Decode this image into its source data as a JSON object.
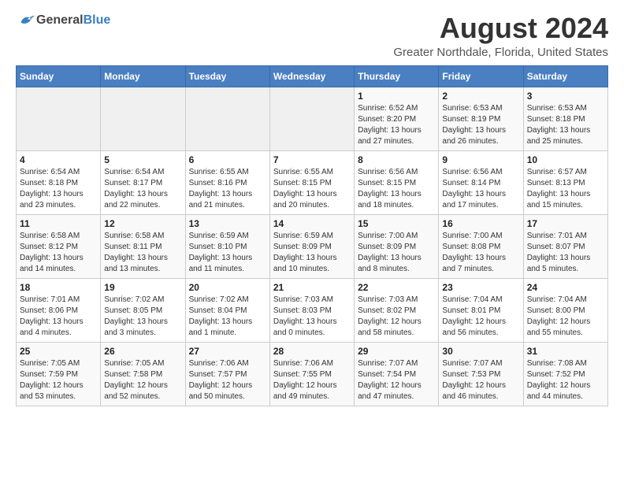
{
  "header": {
    "logo_general": "General",
    "logo_blue": "Blue",
    "title": "August 2024",
    "subtitle": "Greater Northdale, Florida, United States"
  },
  "weekdays": [
    "Sunday",
    "Monday",
    "Tuesday",
    "Wednesday",
    "Thursday",
    "Friday",
    "Saturday"
  ],
  "weeks": [
    [
      {
        "day": "",
        "detail": ""
      },
      {
        "day": "",
        "detail": ""
      },
      {
        "day": "",
        "detail": ""
      },
      {
        "day": "",
        "detail": ""
      },
      {
        "day": "1",
        "detail": "Sunrise: 6:52 AM\nSunset: 8:20 PM\nDaylight: 13 hours and 27 minutes."
      },
      {
        "day": "2",
        "detail": "Sunrise: 6:53 AM\nSunset: 8:19 PM\nDaylight: 13 hours and 26 minutes."
      },
      {
        "day": "3",
        "detail": "Sunrise: 6:53 AM\nSunset: 8:18 PM\nDaylight: 13 hours and 25 minutes."
      }
    ],
    [
      {
        "day": "4",
        "detail": "Sunrise: 6:54 AM\nSunset: 8:18 PM\nDaylight: 13 hours and 23 minutes."
      },
      {
        "day": "5",
        "detail": "Sunrise: 6:54 AM\nSunset: 8:17 PM\nDaylight: 13 hours and 22 minutes."
      },
      {
        "day": "6",
        "detail": "Sunrise: 6:55 AM\nSunset: 8:16 PM\nDaylight: 13 hours and 21 minutes."
      },
      {
        "day": "7",
        "detail": "Sunrise: 6:55 AM\nSunset: 8:15 PM\nDaylight: 13 hours and 20 minutes."
      },
      {
        "day": "8",
        "detail": "Sunrise: 6:56 AM\nSunset: 8:15 PM\nDaylight: 13 hours and 18 minutes."
      },
      {
        "day": "9",
        "detail": "Sunrise: 6:56 AM\nSunset: 8:14 PM\nDaylight: 13 hours and 17 minutes."
      },
      {
        "day": "10",
        "detail": "Sunrise: 6:57 AM\nSunset: 8:13 PM\nDaylight: 13 hours and 15 minutes."
      }
    ],
    [
      {
        "day": "11",
        "detail": "Sunrise: 6:58 AM\nSunset: 8:12 PM\nDaylight: 13 hours and 14 minutes."
      },
      {
        "day": "12",
        "detail": "Sunrise: 6:58 AM\nSunset: 8:11 PM\nDaylight: 13 hours and 13 minutes."
      },
      {
        "day": "13",
        "detail": "Sunrise: 6:59 AM\nSunset: 8:10 PM\nDaylight: 13 hours and 11 minutes."
      },
      {
        "day": "14",
        "detail": "Sunrise: 6:59 AM\nSunset: 8:09 PM\nDaylight: 13 hours and 10 minutes."
      },
      {
        "day": "15",
        "detail": "Sunrise: 7:00 AM\nSunset: 8:09 PM\nDaylight: 13 hours and 8 minutes."
      },
      {
        "day": "16",
        "detail": "Sunrise: 7:00 AM\nSunset: 8:08 PM\nDaylight: 13 hours and 7 minutes."
      },
      {
        "day": "17",
        "detail": "Sunrise: 7:01 AM\nSunset: 8:07 PM\nDaylight: 13 hours and 5 minutes."
      }
    ],
    [
      {
        "day": "18",
        "detail": "Sunrise: 7:01 AM\nSunset: 8:06 PM\nDaylight: 13 hours and 4 minutes."
      },
      {
        "day": "19",
        "detail": "Sunrise: 7:02 AM\nSunset: 8:05 PM\nDaylight: 13 hours and 3 minutes."
      },
      {
        "day": "20",
        "detail": "Sunrise: 7:02 AM\nSunset: 8:04 PM\nDaylight: 13 hours and 1 minute."
      },
      {
        "day": "21",
        "detail": "Sunrise: 7:03 AM\nSunset: 8:03 PM\nDaylight: 13 hours and 0 minutes."
      },
      {
        "day": "22",
        "detail": "Sunrise: 7:03 AM\nSunset: 8:02 PM\nDaylight: 12 hours and 58 minutes."
      },
      {
        "day": "23",
        "detail": "Sunrise: 7:04 AM\nSunset: 8:01 PM\nDaylight: 12 hours and 56 minutes."
      },
      {
        "day": "24",
        "detail": "Sunrise: 7:04 AM\nSunset: 8:00 PM\nDaylight: 12 hours and 55 minutes."
      }
    ],
    [
      {
        "day": "25",
        "detail": "Sunrise: 7:05 AM\nSunset: 7:59 PM\nDaylight: 12 hours and 53 minutes."
      },
      {
        "day": "26",
        "detail": "Sunrise: 7:05 AM\nSunset: 7:58 PM\nDaylight: 12 hours and 52 minutes."
      },
      {
        "day": "27",
        "detail": "Sunrise: 7:06 AM\nSunset: 7:57 PM\nDaylight: 12 hours and 50 minutes."
      },
      {
        "day": "28",
        "detail": "Sunrise: 7:06 AM\nSunset: 7:55 PM\nDaylight: 12 hours and 49 minutes."
      },
      {
        "day": "29",
        "detail": "Sunrise: 7:07 AM\nSunset: 7:54 PM\nDaylight: 12 hours and 47 minutes."
      },
      {
        "day": "30",
        "detail": "Sunrise: 7:07 AM\nSunset: 7:53 PM\nDaylight: 12 hours and 46 minutes."
      },
      {
        "day": "31",
        "detail": "Sunrise: 7:08 AM\nSunset: 7:52 PM\nDaylight: 12 hours and 44 minutes."
      }
    ]
  ]
}
